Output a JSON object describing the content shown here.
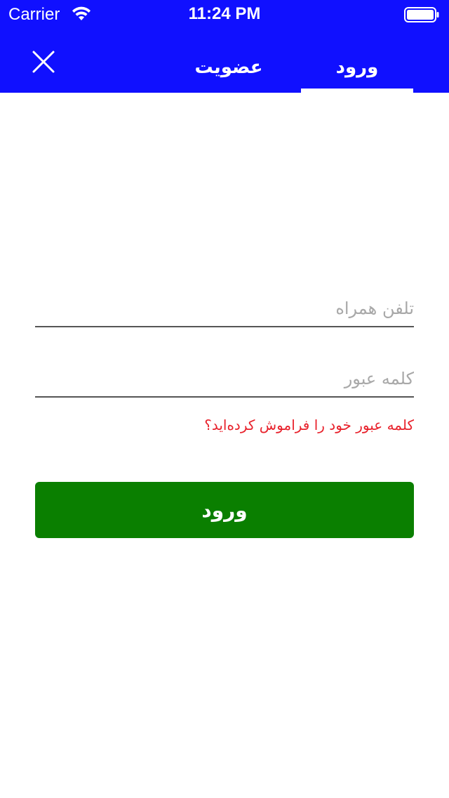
{
  "status_bar": {
    "carrier": "Carrier",
    "time": "11:24 PM",
    "wifi_icon": "wifi-icon",
    "battery_icon": "battery-full-icon"
  },
  "header": {
    "background_color": "#1010FF",
    "close_icon": "close-icon",
    "tabs": [
      {
        "label": "ورود",
        "active": true
      },
      {
        "label": "عضویت",
        "active": false
      }
    ]
  },
  "form": {
    "phone": {
      "value": "",
      "placeholder": "تلفن همراه"
    },
    "password": {
      "value": "",
      "placeholder": "کلمه عبور"
    },
    "forgot_password_label": "کلمه عبور خود را فراموش کرده‌اید؟",
    "forgot_color": "#e8212b",
    "submit_label": "ورود",
    "submit_color": "#0a7f00"
  }
}
